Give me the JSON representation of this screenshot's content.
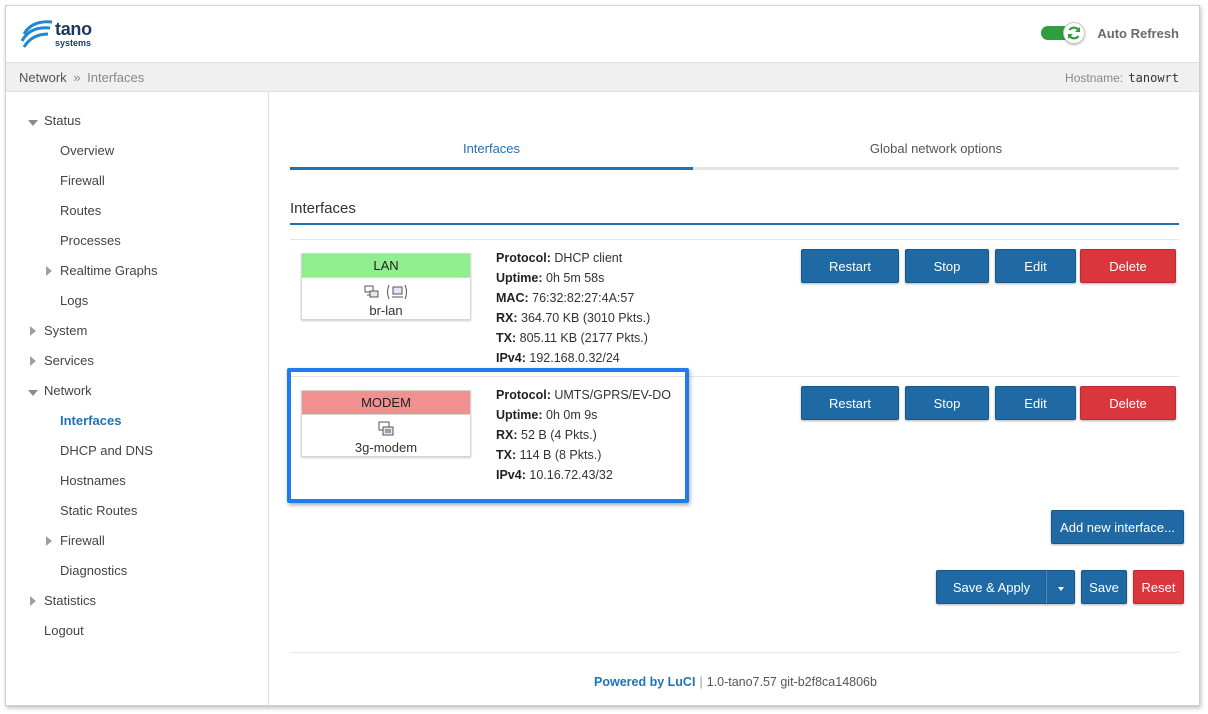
{
  "header": {
    "brand_name": "tano",
    "brand_sub": "systems",
    "auto_refresh_label": "Auto Refresh",
    "auto_refresh_on": true
  },
  "breadcrumb": {
    "parent": "Network",
    "separator": "»",
    "current": "Interfaces"
  },
  "hostname": {
    "label": "Hostname:",
    "value": "tanowrt"
  },
  "sidebar": {
    "items": [
      {
        "label": "Status",
        "level": 0,
        "caret": "down"
      },
      {
        "label": "Overview",
        "level": 1
      },
      {
        "label": "Firewall",
        "level": 1
      },
      {
        "label": "Routes",
        "level": 1
      },
      {
        "label": "Processes",
        "level": 1
      },
      {
        "label": "Realtime Graphs",
        "level": 1,
        "caret": "right"
      },
      {
        "label": "Logs",
        "level": 1
      },
      {
        "label": "System",
        "level": 0,
        "caret": "right"
      },
      {
        "label": "Services",
        "level": 0,
        "caret": "right"
      },
      {
        "label": "Network",
        "level": 0,
        "caret": "down"
      },
      {
        "label": "Interfaces",
        "level": 1,
        "active": true
      },
      {
        "label": "DHCP and DNS",
        "level": 1
      },
      {
        "label": "Hostnames",
        "level": 1
      },
      {
        "label": "Static Routes",
        "level": 1
      },
      {
        "label": "Firewall",
        "level": 1,
        "caret": "right"
      },
      {
        "label": "Diagnostics",
        "level": 1
      },
      {
        "label": "Statistics",
        "level": 0,
        "caret": "right"
      },
      {
        "label": "Logout",
        "level": 0
      }
    ]
  },
  "tabs": [
    {
      "label": "Interfaces",
      "active": true
    },
    {
      "label": "Global network options",
      "active": false
    }
  ],
  "section_title": "Interfaces",
  "interfaces": [
    {
      "name": "LAN",
      "color": "#90ee90",
      "device": "br-lan",
      "details": [
        {
          "key": "Protocol:",
          "value": "DHCP client"
        },
        {
          "key": "Uptime:",
          "value": "0h 5m 58s"
        },
        {
          "key": "MAC:",
          "value": "76:32:82:27:4A:57"
        },
        {
          "key": "RX:",
          "value": "364.70 KB (3010 Pkts.)"
        },
        {
          "key": "TX:",
          "value": "805.11 KB (2177 Pkts.)"
        },
        {
          "key": "IPv4:",
          "value": "192.168.0.32/24"
        }
      ]
    },
    {
      "name": "MODEM",
      "color": "#f09090",
      "device": "3g-modem",
      "details": [
        {
          "key": "Protocol:",
          "value": "UMTS/GPRS/EV-DO"
        },
        {
          "key": "Uptime:",
          "value": "0h 0m 9s"
        },
        {
          "key": "RX:",
          "value": "52 B (4 Pkts.)"
        },
        {
          "key": "TX:",
          "value": "114 B (8 Pkts.)"
        },
        {
          "key": "IPv4:",
          "value": "10.16.72.43/32"
        }
      ]
    }
  ],
  "row_buttons": {
    "restart": "Restart",
    "stop": "Stop",
    "edit": "Edit",
    "delete": "Delete"
  },
  "add_interface_label": "Add new interface...",
  "actions": {
    "save_apply": "Save & Apply",
    "save": "Save",
    "reset": "Reset"
  },
  "footer": {
    "powered": "Powered by LuCI",
    "separator": "|",
    "version": "1.0-tano7.57 git-b2f8ca14806b"
  },
  "colors": {
    "accent": "#1f72b8",
    "button_blue": "#1f6aa5",
    "button_red": "#d9363e",
    "highlight": "#1e7bf0",
    "toggle_on": "#2e9e3e"
  }
}
